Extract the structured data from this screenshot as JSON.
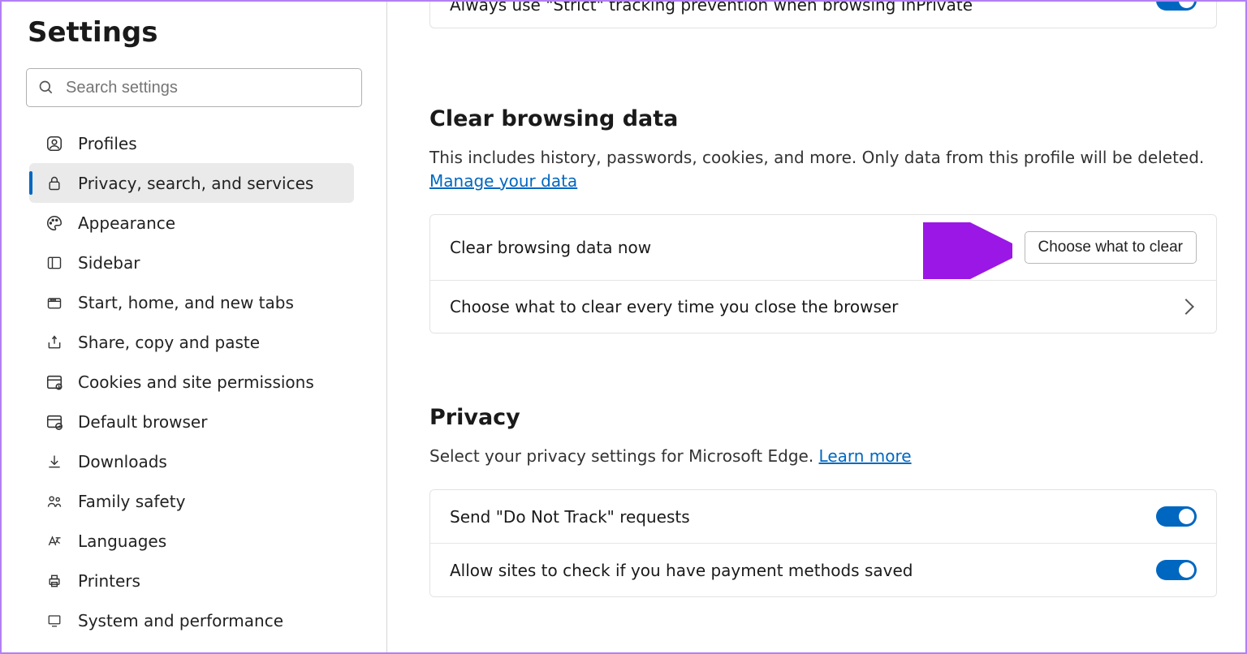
{
  "sidebar": {
    "title": "Settings",
    "search_placeholder": "Search settings",
    "items": [
      {
        "label": "Profiles"
      },
      {
        "label": "Privacy, search, and services"
      },
      {
        "label": "Appearance"
      },
      {
        "label": "Sidebar"
      },
      {
        "label": "Start, home, and new tabs"
      },
      {
        "label": "Share, copy and paste"
      },
      {
        "label": "Cookies and site permissions"
      },
      {
        "label": "Default browser"
      },
      {
        "label": "Downloads"
      },
      {
        "label": "Family safety"
      },
      {
        "label": "Languages"
      },
      {
        "label": "Printers"
      },
      {
        "label": "System and performance"
      }
    ],
    "active_index": 1
  },
  "top_row": {
    "label": "Always use \"Strict\" tracking prevention when browsing InPrivate",
    "on": true
  },
  "clear_section": {
    "title": "Clear browsing data",
    "desc_prefix": "This includes history, passwords, cookies, and more. Only data from this profile will be deleted. ",
    "desc_link": "Manage your data",
    "rows": {
      "now": "Clear browsing data now",
      "now_button": "Choose what to clear",
      "every_close": "Choose what to clear every time you close the browser"
    }
  },
  "privacy_section": {
    "title": "Privacy",
    "desc_prefix": "Select your privacy settings for Microsoft Edge. ",
    "desc_link": "Learn more",
    "rows": {
      "dnt": "Send \"Do Not Track\" requests",
      "dnt_on": true,
      "payment": "Allow sites to check if you have payment methods saved",
      "payment_on": true
    }
  }
}
